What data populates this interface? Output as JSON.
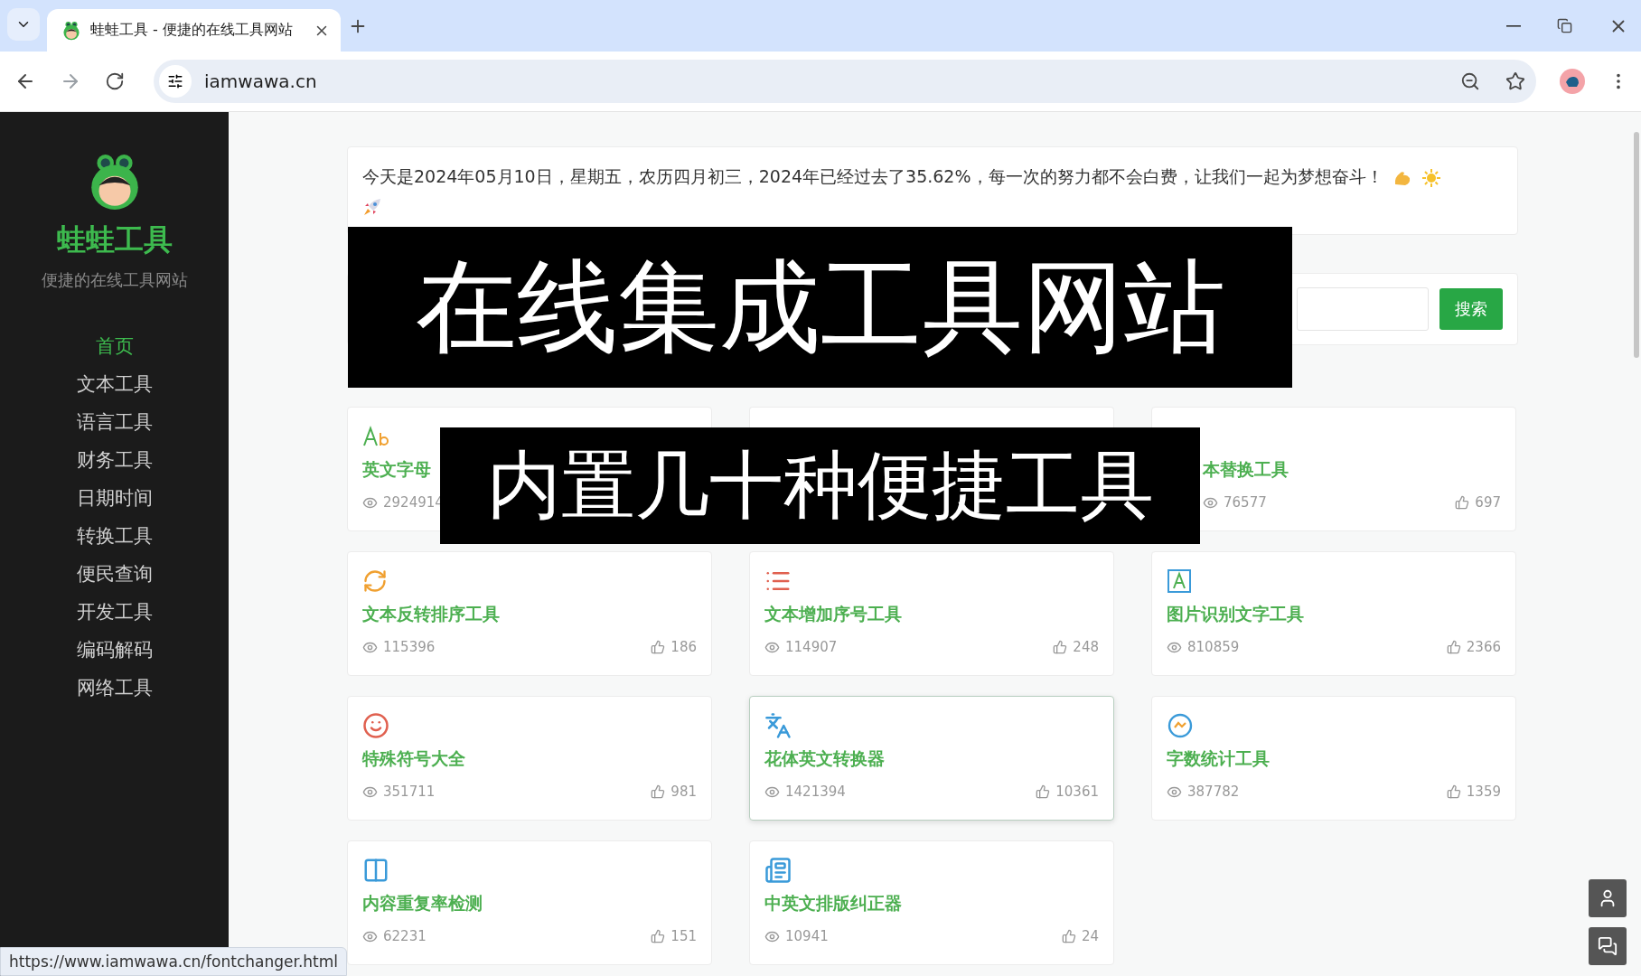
{
  "browser": {
    "tab_title": "蛙蛙工具 - 便捷的在线工具网站",
    "url": "iamwawa.cn",
    "status_url": "https://www.iamwawa.cn/fontchanger.html"
  },
  "sidebar": {
    "title": "蛙蛙工具",
    "subtitle": "便捷的在线工具网站",
    "items": [
      {
        "label": "首页",
        "selected": true
      },
      {
        "label": "文本工具",
        "selected": false
      },
      {
        "label": "语言工具",
        "selected": false
      },
      {
        "label": "财务工具",
        "selected": false
      },
      {
        "label": "日期时间",
        "selected": false
      },
      {
        "label": "转换工具",
        "selected": false
      },
      {
        "label": "便民查询",
        "selected": false
      },
      {
        "label": "开发工具",
        "selected": false
      },
      {
        "label": "编码解码",
        "selected": false
      },
      {
        "label": "网络工具",
        "selected": false
      }
    ]
  },
  "notice": "今天是2024年05月10日，星期五，农历四月初三，2024年已经过去了35.62%，每一次的努力都不会白费，让我们一起为梦想奋斗！",
  "search": {
    "button": "搜索"
  },
  "cards": [
    {
      "kind": "left-covered",
      "title": "英文字母",
      "views": "2924914",
      "hovered": false
    },
    {
      "kind": "hidden",
      "hovered": false
    },
    {
      "kind": "right-covered",
      "title": "本替换工具",
      "views": "76577",
      "likes": "697",
      "hovered": false
    },
    {
      "kind": "full",
      "title": "文本反转排序工具",
      "views": "115396",
      "likes": "186",
      "hovered": false
    },
    {
      "kind": "full",
      "title": "文本增加序号工具",
      "views": "114907",
      "likes": "248",
      "hovered": false
    },
    {
      "kind": "full",
      "title": "图片识别文字工具",
      "views": "810859",
      "likes": "2366",
      "hovered": false
    },
    {
      "kind": "full",
      "title": "特殊符号大全",
      "views": "351711",
      "likes": "981",
      "hovered": false
    },
    {
      "kind": "full",
      "title": "花体英文转换器",
      "views": "1421394",
      "likes": "10361",
      "hovered": true
    },
    {
      "kind": "full",
      "title": "字数统计工具",
      "views": "387782",
      "likes": "1359",
      "hovered": false
    },
    {
      "kind": "full",
      "title": "内容重复率检测",
      "views": "62231",
      "likes": "151",
      "hovered": false
    },
    {
      "kind": "full",
      "title": "中英文排版纠正器",
      "views": "10941",
      "likes": "24",
      "hovered": false
    }
  ],
  "captions": [
    "在线集成工具网站",
    "内置几十种便捷工具"
  ]
}
